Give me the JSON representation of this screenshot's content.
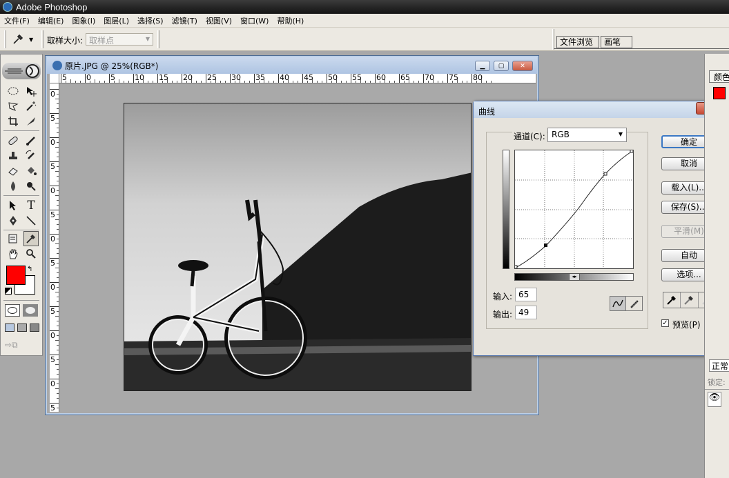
{
  "app": {
    "title": "Adobe Photoshop"
  },
  "menu": [
    "文件(F)",
    "编辑(E)",
    "图象(I)",
    "图层(L)",
    "选择(S)",
    "滤镜(T)",
    "视图(V)",
    "窗口(W)",
    "帮助(H)"
  ],
  "options": {
    "sample_size_label": "取样大小:",
    "sample_size_value": "取样点"
  },
  "tabs": {
    "file_browser": "文件浏览",
    "brushes": "画笔"
  },
  "document": {
    "title": "原片.JPG @ 25%(RGB*)",
    "ruler_h": [
      "5",
      "0",
      "5",
      "10",
      "15",
      "20",
      "25",
      "30",
      "35",
      "40",
      "45",
      "50",
      "55",
      "60",
      "65",
      "70",
      "75",
      "80"
    ],
    "ruler_v": [
      "0",
      "5",
      "0",
      "5",
      "0",
      "5",
      "0",
      "5",
      "0",
      "5",
      "0",
      "5",
      "0",
      "5"
    ]
  },
  "curves": {
    "title": "曲线",
    "channel_label": "通道(C):",
    "channel_value": "RGB",
    "ok": "确定",
    "cancel": "取消",
    "load": "载入(L)...",
    "save": "保存(S)...",
    "smooth": "平滑(M)",
    "auto": "自动",
    "options": "选项...",
    "input_label": "输入:",
    "input_value": "65",
    "output_label": "输出:",
    "output_value": "49",
    "preview_label": "预览(P)"
  },
  "right_panel": {
    "tab": "颜色",
    "mode": "正常",
    "lock": "锁定:"
  },
  "colors": {
    "foreground": "#ff0000",
    "background": "#ffffff"
  }
}
